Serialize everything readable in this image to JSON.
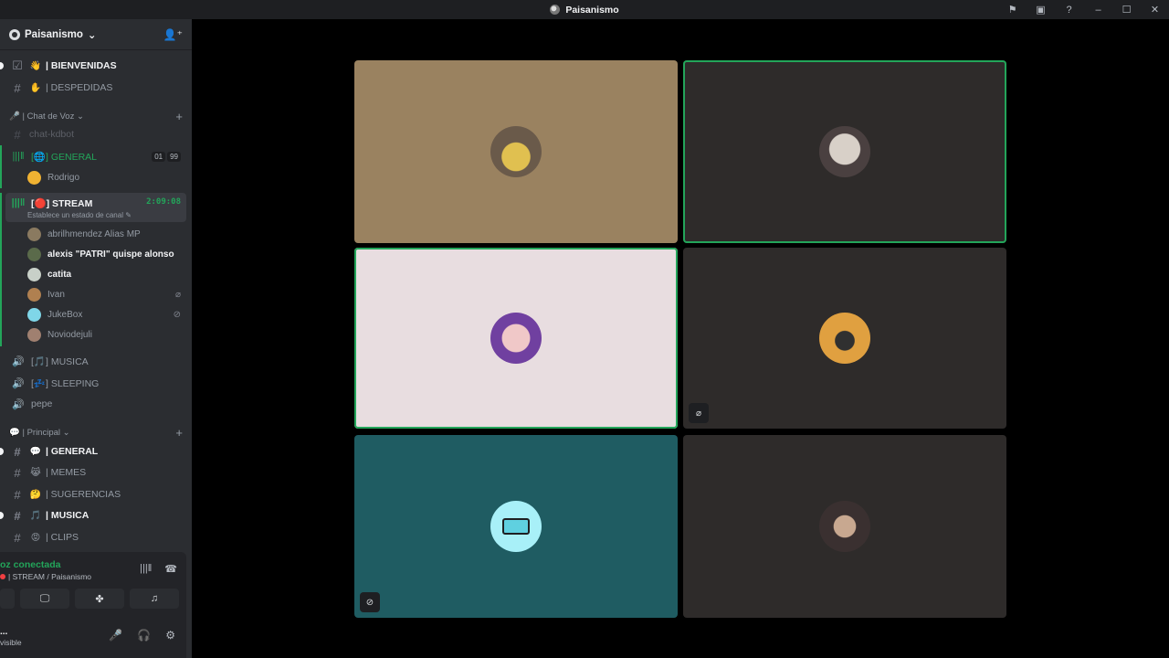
{
  "window": {
    "title": "Paisanismo"
  },
  "server": {
    "name": "Paisanismo"
  },
  "channels_top": [
    {
      "name": "| BIENVENIDAS",
      "emoji": "👋",
      "bold": true,
      "unread": true
    },
    {
      "name": "| DESPEDIDAS",
      "emoji": "✋",
      "bold": false,
      "unread": false
    }
  ],
  "category_voice": {
    "label": "🎤 | Chat de Voz",
    "chevron": "⌄"
  },
  "chat_kdbot": "chat-kdbot",
  "voice_general": {
    "name": "[🌐] GENERAL",
    "counts": [
      "01",
      "99"
    ],
    "users": [
      {
        "name": "Rodrigo",
        "color": "#f0b232"
      }
    ]
  },
  "voice_stream": {
    "name": "[🔴] STREAM",
    "timer": "2:09:08",
    "status": "Establece un estado de canal ✎",
    "users": [
      {
        "name": "abrilhmendez Alias MP",
        "bold": false,
        "color": "#8a7a60",
        "icon": ""
      },
      {
        "name": "alexis \"PATRI\" quispe alonso",
        "bold": true,
        "color": "#5a6a4a",
        "icon": ""
      },
      {
        "name": "catita",
        "bold": true,
        "color": "#c8d0c8",
        "icon": ""
      },
      {
        "name": "Ivan",
        "bold": false,
        "color": "#b08050",
        "icon": "🎙̸"
      },
      {
        "name": "JukeBox",
        "bold": false,
        "color": "#7fd6e8",
        "icon": "⊘"
      },
      {
        "name": "Noviodejuli",
        "bold": false,
        "color": "#a08070",
        "icon": ""
      }
    ]
  },
  "voice_others": [
    {
      "name": "[🎵] MUSICA"
    },
    {
      "name": "[💤] SLEEPING"
    },
    {
      "name": "pepe"
    }
  ],
  "category_main": {
    "label": "💬 | Principal",
    "chevron": "⌄"
  },
  "channels_main": [
    {
      "name": "| GENERAL",
      "emoji": "💬",
      "bold": true,
      "unread": true
    },
    {
      "name": "| MEMES",
      "emoji": "😹",
      "bold": false,
      "unread": false
    },
    {
      "name": "| SUGERENCIAS",
      "emoji": "🤔",
      "bold": false,
      "unread": false
    },
    {
      "name": "| MUSICA",
      "emoji": "🎵",
      "bold": true,
      "unread": true
    },
    {
      "name": "| CLIPS",
      "emoji": "😡",
      "bold": false,
      "unread": false
    }
  ],
  "voice_panel": {
    "title": "oz conectada",
    "subtitle": "| STREAM / Paisanismo"
  },
  "user_panel": {
    "name": "...",
    "status": "visible"
  },
  "tiles": [
    {
      "bg": "#9a8260",
      "speaking": false,
      "avatar": "#e0c050",
      "corner": ""
    },
    {
      "bg": "#2e2b2a",
      "speaking": true,
      "avatar": "#d8d0c8",
      "corner": ""
    },
    {
      "bg": "#e8dde0",
      "speaking": true,
      "avatar": "#7040a0",
      "corner": ""
    },
    {
      "bg": "#2e2b2a",
      "speaking": false,
      "avatar": "#e0a040",
      "corner": "mic-off"
    },
    {
      "bg": "#1f5c62",
      "speaking": false,
      "avatar": "#a8f0f8",
      "corner": "deafened"
    },
    {
      "bg": "#2e2b2a",
      "speaking": false,
      "avatar": "#6a5a50",
      "corner": ""
    }
  ],
  "colors": {
    "accent_green": "#23a55a",
    "sidebar_bg": "#2b2d31",
    "titlebar_bg": "#1e1f22"
  }
}
